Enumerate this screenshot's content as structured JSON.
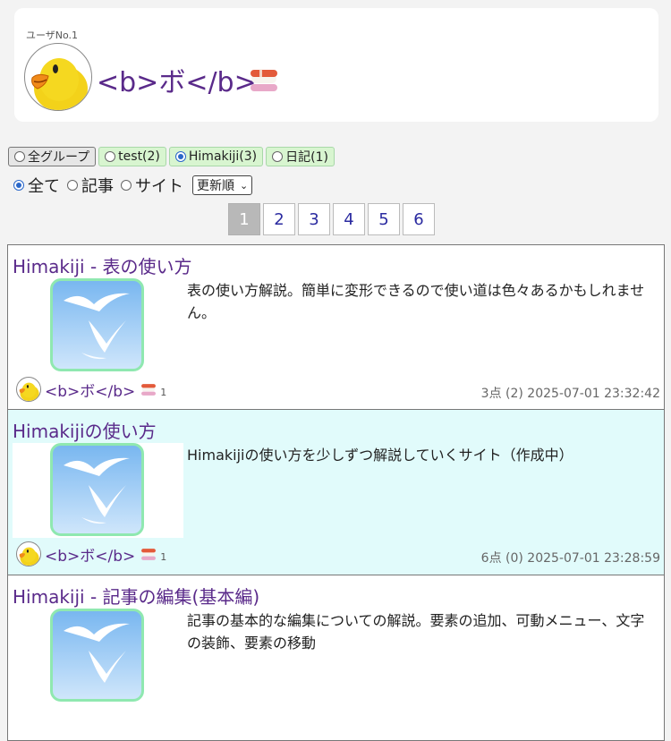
{
  "header": {
    "user_number": "ユーザNo.1",
    "user_name": "<b>ボ</b>",
    "avatar_icon": "yellow-chick-avatar-icon",
    "badge_icon": "sushi-icon"
  },
  "groups": [
    {
      "label": "全グループ",
      "selected": false
    },
    {
      "label": "test(2)",
      "selected": false
    },
    {
      "label": "Himakiji(3)",
      "selected": true
    },
    {
      "label": "日記(1)",
      "selected": false
    }
  ],
  "types": [
    {
      "label": "全て",
      "selected": true
    },
    {
      "label": "記事",
      "selected": false
    },
    {
      "label": "サイト",
      "selected": false
    }
  ],
  "sort": {
    "value": "更新順"
  },
  "pagination": {
    "current": "1",
    "pages": [
      "1",
      "2",
      "3",
      "4",
      "5",
      "6"
    ]
  },
  "articles": [
    {
      "title": "Himakiji - 表の使い方",
      "description": "表の使い方解説。簡単に変形できるので使い道は色々あるかもしれません。",
      "author": "<b>ボ</b>",
      "sushi_count": "1",
      "meta": "3点 (2) 2025-07-01 23:32:42",
      "thumbnail_icon": "bird-thumbnail-icon"
    },
    {
      "title": "Himakijiの使い方",
      "description": "Himakijiの使い方を少しずつ解説していくサイト（作成中）",
      "author": "<b>ボ</b>",
      "sushi_count": "1",
      "meta": "6点 (0) 2025-07-01 23:28:59",
      "thumbnail_icon": "bird-thumbnail-icon"
    },
    {
      "title": "Himakiji - 記事の編集(基本編)",
      "description": "記事の基本的な編集についての解説。要素の追加、可動メニュー、文字の装飾、要素の移動",
      "author": "",
      "sushi_count": "",
      "meta": "",
      "thumbnail_icon": "bird-thumbnail-icon"
    }
  ],
  "colors": {
    "title_purple": "#5a2a8a",
    "group_green": "#d8f5d0",
    "highlight_cyan": "#e1fbfb",
    "thumb_border": "#8fe8b0"
  }
}
